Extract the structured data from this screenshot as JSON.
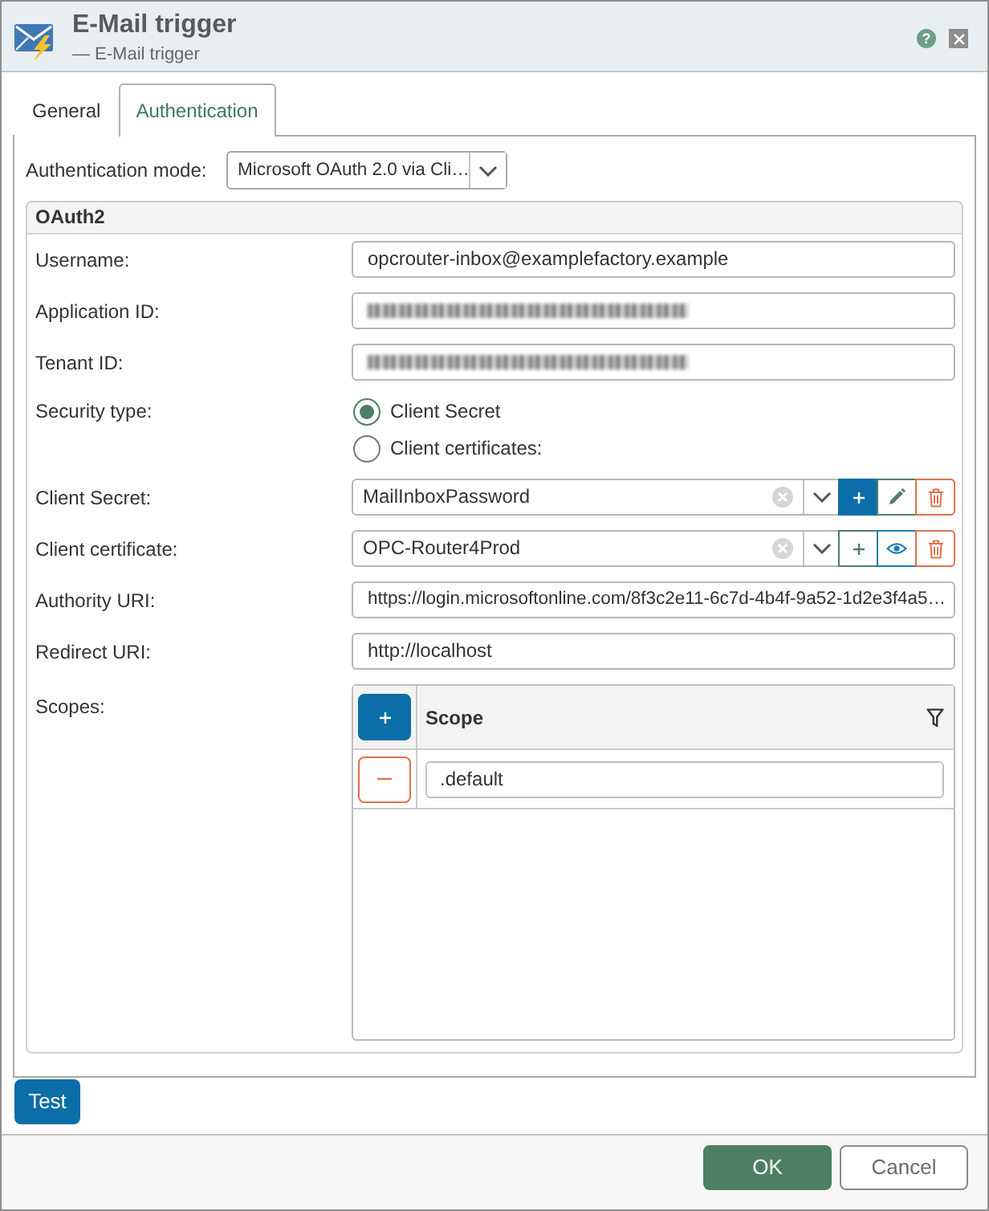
{
  "window": {
    "title": "E-Mail trigger",
    "subtitle": "— E-Mail trigger",
    "help": "?"
  },
  "tabs": [
    {
      "label": "General",
      "selected": false
    },
    {
      "label": "Authentication",
      "selected": true
    }
  ],
  "authentication_mode": {
    "label": "Authentication mode:",
    "value": "Microsoft OAuth 2.0 via Cli…"
  },
  "oauth2": {
    "title": "OAuth2",
    "rows": [
      {
        "kind": "text",
        "label": "Username:",
        "value": "opcrouter-inbox@examplefactory.example"
      },
      {
        "kind": "redacted",
        "label": "Application ID:"
      },
      {
        "kind": "redacted",
        "label": "Tenant ID:"
      },
      {
        "kind": "radio",
        "label": "Security type:",
        "options": [
          {
            "label": "Client Secret",
            "selected": true
          },
          {
            "label": "Client certificates:",
            "selected": false
          }
        ]
      },
      {
        "kind": "combo",
        "label": "Client Secret:",
        "value": "MailInboxPassword",
        "actions": [
          {
            "kind": "add",
            "primary": true
          },
          {
            "kind": "edit",
            "primary": false
          },
          {
            "kind": "delete",
            "primary": false
          }
        ]
      },
      {
        "kind": "combo",
        "label": "Client certificate:",
        "value": "OPC-Router4Prod",
        "actions": [
          {
            "kind": "add",
            "primary": false
          },
          {
            "kind": "view",
            "primary": false
          },
          {
            "kind": "delete",
            "primary": false
          }
        ]
      },
      {
        "kind": "text",
        "label": "Authority URI:",
        "value": "https://login.microsoftonline.com/8f3c2e11-6c7d-4b4f-9a52-1d2e3f4a5…"
      },
      {
        "kind": "text",
        "label": "Redirect URI:",
        "value": "http://localhost"
      },
      {
        "kind": "table",
        "label": "Scopes:",
        "columns": [
          {
            "label": "Scope"
          }
        ],
        "rows": [
          {
            "value": ".default"
          }
        ]
      }
    ]
  },
  "test_button": "Test",
  "footer_buttons": [
    {
      "kind": "primary",
      "label": "OK"
    },
    {
      "kind": "secondary",
      "label": "Cancel"
    }
  ]
}
